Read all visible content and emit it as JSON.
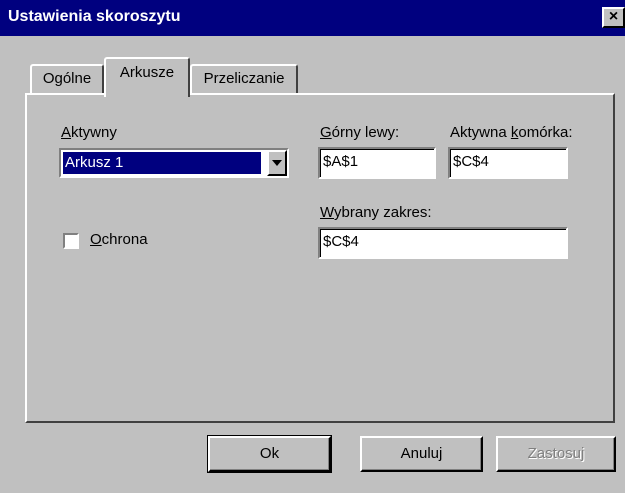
{
  "window": {
    "title": "Ustawienia skoroszytu",
    "close_label": "×"
  },
  "tabs": [
    {
      "label": "Ogólne"
    },
    {
      "label": "Arkusze"
    },
    {
      "label": "Przeliczanie"
    }
  ],
  "sheet": {
    "active_label_key": "A",
    "active_label_rest": "ktywny",
    "active_value": "Arkusz 1",
    "protection_label_key": "O",
    "protection_label_rest": "chrona",
    "protection_checked": false
  },
  "fields": {
    "top_left_label_key": "G",
    "top_left_label_rest": "órny lewy:",
    "top_left_value": "$A$1",
    "active_cell_label_pre": "Aktywna ",
    "active_cell_label_key": "k",
    "active_cell_label_post": "omórka:",
    "active_cell_value": "$C$4",
    "range_label_key": "W",
    "range_label_rest": "ybrany zakres:",
    "range_value": "$C$4"
  },
  "buttons": {
    "ok": "Ok",
    "cancel": "Anuluj",
    "apply": "Zastosuj"
  },
  "colors": {
    "titlebar": "#00007f",
    "window_bg": "#c0c0c0",
    "selection": "#00007f"
  }
}
